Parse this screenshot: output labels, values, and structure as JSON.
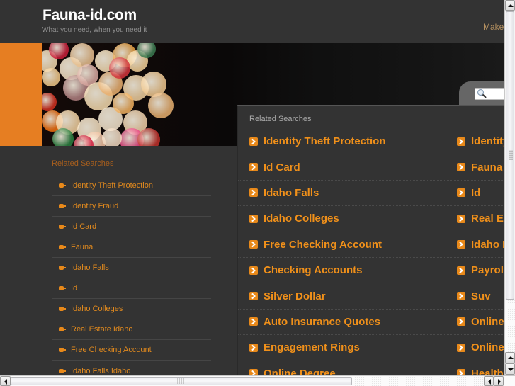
{
  "header": {
    "site_title": "Fauna-id.com",
    "tagline": "What you need, when you need it",
    "make_link": "Make"
  },
  "banner": {
    "image_desc": "bokeh-lights",
    "search_placeholder": ""
  },
  "sidebar": {
    "heading": "Related Searches",
    "items": [
      {
        "label": "Identity Theft Protection"
      },
      {
        "label": "Identity Fraud"
      },
      {
        "label": "Id Card"
      },
      {
        "label": "Fauna"
      },
      {
        "label": "Idaho Falls"
      },
      {
        "label": "Id"
      },
      {
        "label": "Idaho Colleges"
      },
      {
        "label": "Real Estate Idaho"
      },
      {
        "label": "Free Checking Account"
      },
      {
        "label": "Idaho Falls Idaho"
      }
    ]
  },
  "related": {
    "heading": "Related Searches",
    "rows": [
      {
        "left": "Identity Theft Protection",
        "right": "Identity"
      },
      {
        "left": "Id Card",
        "right": "Fauna"
      },
      {
        "left": "Idaho Falls",
        "right": "Id"
      },
      {
        "left": "Idaho Colleges",
        "right": "Real Es"
      },
      {
        "left": "Free Checking Account",
        "right": "Idaho F"
      },
      {
        "left": "Checking Accounts",
        "right": "Payroll"
      },
      {
        "left": "Silver Dollar",
        "right": "Suv"
      },
      {
        "left": "Auto Insurance Quotes",
        "right": "Online"
      },
      {
        "left": "Engagement Rings",
        "right": "Online"
      },
      {
        "left": "Online Degree",
        "right": "Health"
      }
    ]
  },
  "colors": {
    "accent_orange": "#e67e22",
    "link_orange": "#f0901a",
    "background": "#333333"
  }
}
